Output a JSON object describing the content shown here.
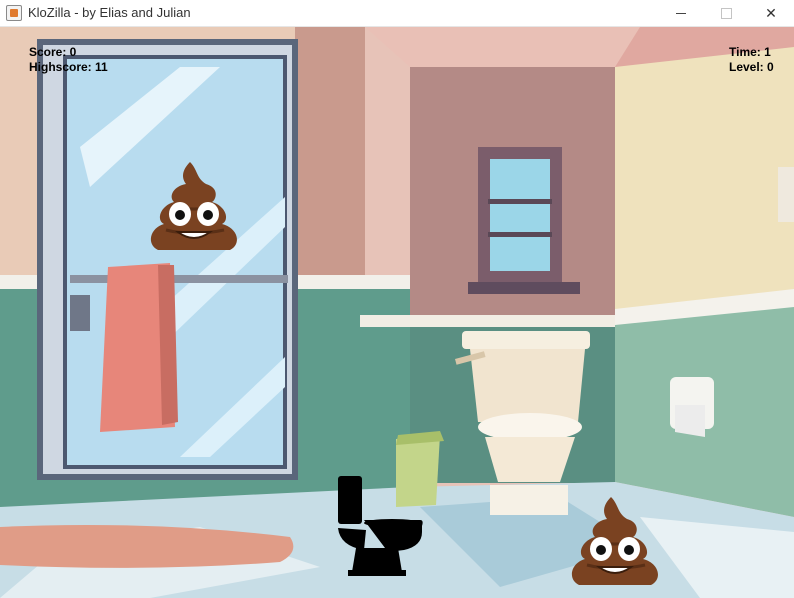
{
  "window": {
    "title": "KloZilla - by Elias and Julian",
    "icon": "java-app-icon",
    "controls": [
      "minimize",
      "maximize",
      "close"
    ]
  },
  "hud": {
    "score_label": "Score: 0",
    "highscore_label": "Highscore: 11",
    "time_label": "Time: 1",
    "level_label": "Level: 0"
  },
  "game": {
    "score": 0,
    "highscore": 11,
    "time": 1,
    "level": 0,
    "scene": "cartoon-bathroom",
    "entities": [
      "poop-emoji",
      "poop-emoji",
      "toilet-player"
    ]
  },
  "colors": {
    "poop": "#7a4221",
    "player": "#000000",
    "wall_pink": "#d9a7a1",
    "wall_green": "#5e9e8e",
    "floor": "#bcd8e6"
  }
}
